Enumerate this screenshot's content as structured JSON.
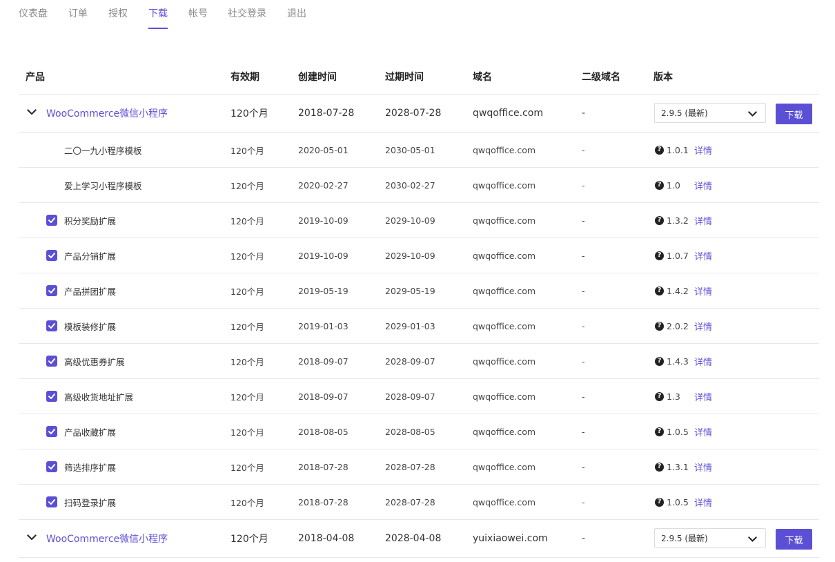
{
  "nav": {
    "tabs": [
      "仪表盘",
      "订单",
      "授权",
      "下载",
      "帐号",
      "社交登录",
      "退出"
    ],
    "active": "下载"
  },
  "table": {
    "headers": {
      "product": "产品",
      "validity": "有效期",
      "created": "创建时间",
      "expires": "过期时间",
      "domain": "域名",
      "subdomain": "二级域名",
      "version": "版本"
    },
    "detail_label": "详情",
    "download_label": "下载",
    "groups": [
      {
        "name": "WooCommerce微信小程序",
        "validity": "120个月",
        "created": "2018-07-28",
        "expires": "2028-07-28",
        "domain": "qwqoffice.com",
        "subdomain": "-",
        "version_selected": "2.9.5 (最新)",
        "children": [
          {
            "name": "二〇一九小程序模板",
            "checked": false,
            "validity": "120个月",
            "created": "2020-05-01",
            "expires": "2030-05-01",
            "domain": "qwqoffice.com",
            "subdomain": "-",
            "version": "1.0.1"
          },
          {
            "name": "爱上学习小程序模板",
            "checked": false,
            "validity": "120个月",
            "created": "2020-02-27",
            "expires": "2030-02-27",
            "domain": "qwqoffice.com",
            "subdomain": "-",
            "version": "1.0"
          },
          {
            "name": "积分奖励扩展",
            "checked": true,
            "validity": "120个月",
            "created": "2019-10-09",
            "expires": "2029-10-09",
            "domain": "qwqoffice.com",
            "subdomain": "-",
            "version": "1.3.2"
          },
          {
            "name": "产品分销扩展",
            "checked": true,
            "validity": "120个月",
            "created": "2019-10-09",
            "expires": "2029-10-09",
            "domain": "qwqoffice.com",
            "subdomain": "-",
            "version": "1.0.7"
          },
          {
            "name": "产品拼团扩展",
            "checked": true,
            "validity": "120个月",
            "created": "2019-05-19",
            "expires": "2029-05-19",
            "domain": "qwqoffice.com",
            "subdomain": "-",
            "version": "1.4.2"
          },
          {
            "name": "模板装修扩展",
            "checked": true,
            "validity": "120个月",
            "created": "2019-01-03",
            "expires": "2029-01-03",
            "domain": "qwqoffice.com",
            "subdomain": "-",
            "version": "2.0.2"
          },
          {
            "name": "高级优惠券扩展",
            "checked": true,
            "validity": "120个月",
            "created": "2018-09-07",
            "expires": "2028-09-07",
            "domain": "qwqoffice.com",
            "subdomain": "-",
            "version": "1.4.3"
          },
          {
            "name": "高级收货地址扩展",
            "checked": true,
            "validity": "120个月",
            "created": "2018-09-07",
            "expires": "2028-09-07",
            "domain": "qwqoffice.com",
            "subdomain": "-",
            "version": "1.3"
          },
          {
            "name": "产品收藏扩展",
            "checked": true,
            "validity": "120个月",
            "created": "2018-08-05",
            "expires": "2028-08-05",
            "domain": "qwqoffice.com",
            "subdomain": "-",
            "version": "1.0.5"
          },
          {
            "name": "筛选排序扩展",
            "checked": true,
            "validity": "120个月",
            "created": "2018-07-28",
            "expires": "2028-07-28",
            "domain": "qwqoffice.com",
            "subdomain": "-",
            "version": "1.3.1"
          },
          {
            "name": "扫码登录扩展",
            "checked": true,
            "validity": "120个月",
            "created": "2018-07-28",
            "expires": "2028-07-28",
            "domain": "qwqoffice.com",
            "subdomain": "-",
            "version": "1.0.5"
          }
        ]
      },
      {
        "name": "WooCommerce微信小程序",
        "validity": "120个月",
        "created": "2018-04-08",
        "expires": "2028-04-08",
        "domain": "yuixiaowei.com",
        "subdomain": "-",
        "version_selected": "2.9.5 (最新)",
        "children": []
      }
    ]
  },
  "colors": {
    "accent": "#5b4fd6",
    "text": "#333333",
    "muted": "#8a8a8a",
    "border": "#e8e8e8"
  },
  "icons": {
    "expand": "chevron-down-icon",
    "select_caret": "chevron-down-icon",
    "checkbox": "check-icon",
    "version_info": "question-circle-icon"
  }
}
